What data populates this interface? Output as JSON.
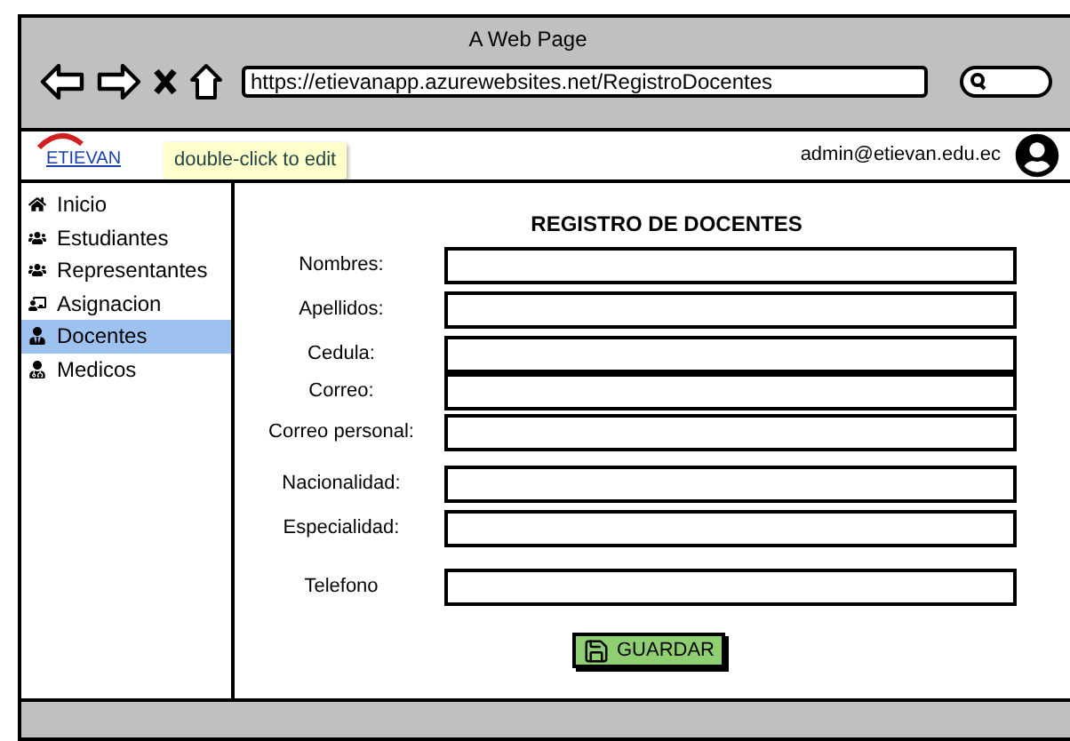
{
  "window": {
    "title": "A Web Page",
    "url": "https://etievanapp.azurewebsites.net/RegistroDocentes"
  },
  "header": {
    "logo_text": "ETIEVAN",
    "user": "admin@etievan.edu.ec",
    "tooltip": "double-click to edit"
  },
  "sidebar": {
    "items": [
      {
        "label": "Inicio",
        "selected": false
      },
      {
        "label": "Estudiantes",
        "selected": false
      },
      {
        "label": "Representantes",
        "selected": false
      },
      {
        "label": "Asignacion",
        "selected": false
      },
      {
        "label": "Docentes",
        "selected": true
      },
      {
        "label": "Medicos",
        "selected": false
      }
    ]
  },
  "form": {
    "title": "REGISTRO DE DOCENTES",
    "fields": [
      {
        "label": "Nombres:"
      },
      {
        "label": "Apellidos:"
      },
      {
        "label": "Cedula:"
      },
      {
        "label": "Correo:"
      },
      {
        "label": "Correo personal:"
      },
      {
        "label": "Nacionalidad:"
      },
      {
        "label": "Especialidad:"
      },
      {
        "label": "Telefono"
      }
    ],
    "button": "GUARDAR"
  }
}
